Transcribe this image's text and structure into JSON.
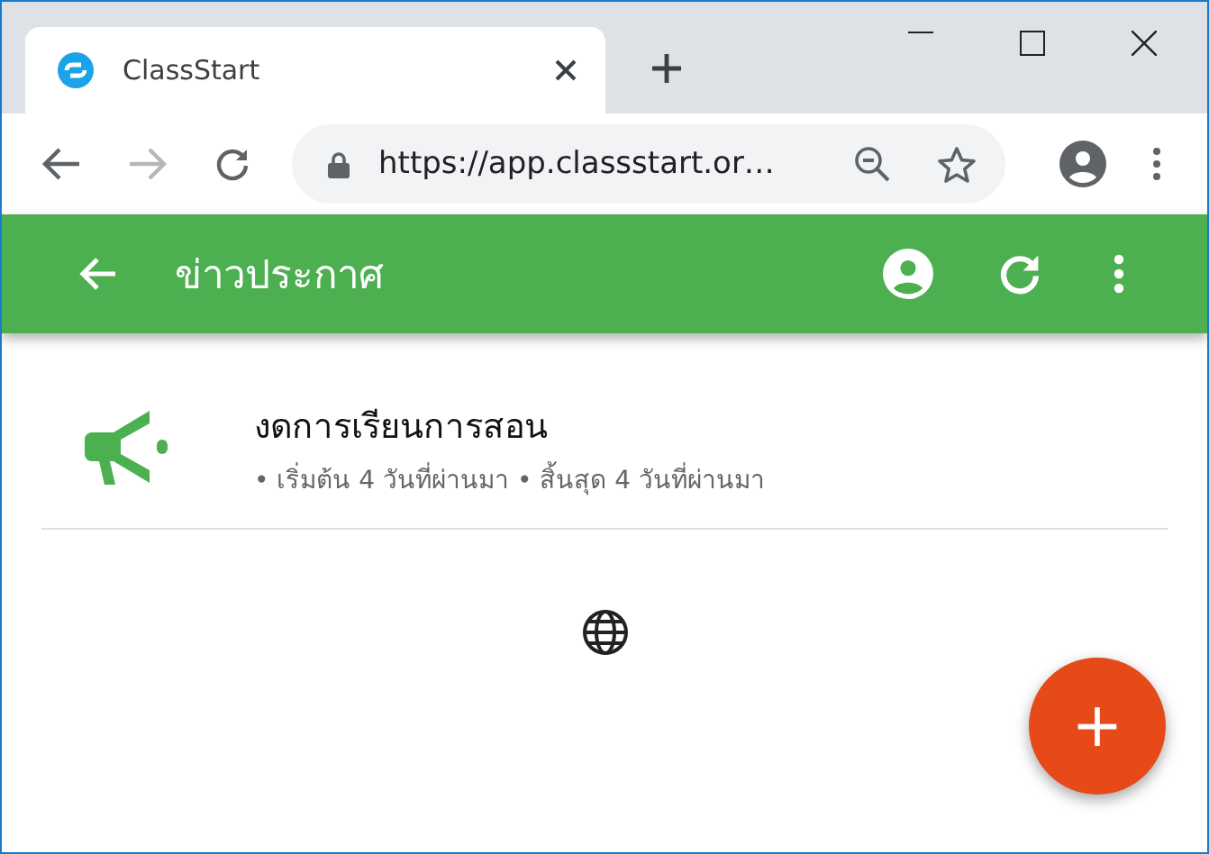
{
  "browser": {
    "tab_title": "ClassStart",
    "url": "https://app.classstart.or…"
  },
  "app_bar": {
    "title": "ข่าวประกาศ"
  },
  "announcements": [
    {
      "title": "งดการเรียนการสอน",
      "meta": "• เริ่มต้น 4 วันที่ผ่านมา • สิ้นสุด 4 วันที่ผ่านมา"
    }
  ],
  "fab": {
    "label": "+"
  }
}
